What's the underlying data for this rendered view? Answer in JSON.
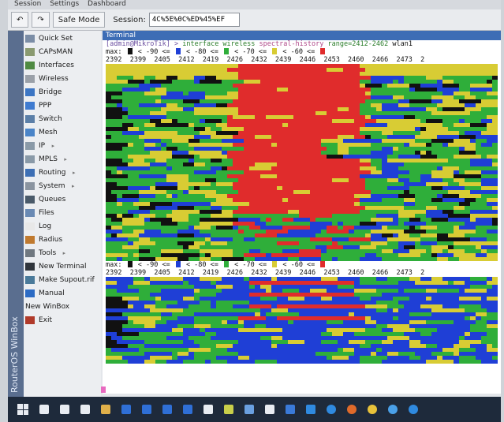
{
  "menubar": [
    "Session",
    "Settings",
    "Dashboard"
  ],
  "toolbar": {
    "undo": "↶",
    "redo": "↷",
    "safe_mode": "Safe Mode",
    "session_label": "Session:",
    "session_value": "4C%5E%0C%ED%45%EF"
  },
  "sidebar": {
    "brand": "RouterOS WinBox",
    "items": [
      {
        "label": "Quick Set",
        "icon": "quick-set-icon",
        "color": "#7b8da6"
      },
      {
        "label": "CAPsMAN",
        "icon": "capsman-icon",
        "color": "#8a9a70"
      },
      {
        "label": "Interfaces",
        "icon": "interfaces-icon",
        "color": "#4f8a42"
      },
      {
        "label": "Wireless",
        "icon": "wireless-icon",
        "color": "#9aa0a8"
      },
      {
        "label": "Bridge",
        "icon": "bridge-icon",
        "color": "#3c76c4"
      },
      {
        "label": "PPP",
        "icon": "ppp-icon",
        "color": "#3f7bd0"
      },
      {
        "label": "Switch",
        "icon": "switch-icon",
        "color": "#5b7fa8"
      },
      {
        "label": "Mesh",
        "icon": "mesh-icon",
        "color": "#4a84c8"
      },
      {
        "label": "IP",
        "icon": "ip-icon",
        "color": "#8a9aa8",
        "arrow": true
      },
      {
        "label": "MPLS",
        "icon": "mpls-icon",
        "color": "#8a9aa8",
        "arrow": true
      },
      {
        "label": "Routing",
        "icon": "routing-icon",
        "color": "#3d6fb5",
        "arrow": true
      },
      {
        "label": "System",
        "icon": "system-icon",
        "color": "#8a94a0",
        "arrow": true
      },
      {
        "label": "Queues",
        "icon": "queues-icon",
        "color": "#4a5a6a"
      },
      {
        "label": "Files",
        "icon": "files-icon",
        "color": "#6a8ab4"
      },
      {
        "label": "Log",
        "icon": "log-icon",
        "color": "#e8e8e8"
      },
      {
        "label": "Radius",
        "icon": "radius-icon",
        "color": "#c07a30"
      },
      {
        "label": "Tools",
        "icon": "tools-icon",
        "color": "#707880",
        "arrow": true
      },
      {
        "label": "New Terminal",
        "icon": "terminal-icon",
        "color": "#30353c"
      },
      {
        "label": "Make Supout.rif",
        "icon": "supout-icon",
        "color": "#4a7a9a"
      },
      {
        "label": "Manual",
        "icon": "manual-icon",
        "color": "#2c6bc4"
      },
      {
        "label": "New WinBox",
        "icon": "",
        "color": ""
      },
      {
        "label": "Exit",
        "icon": "exit-icon",
        "color": "#b03a2a"
      }
    ]
  },
  "terminal": {
    "title": "Terminal",
    "prompt": "[admin@MikroTik] >",
    "command_kw": "interface wireless",
    "command_kw2": "spectral-history",
    "command_args": "range=2412-2462",
    "command_iface": "wlan1",
    "legend": {
      "max": "max:",
      "t1": "< -90 <=",
      "t2": "< -80 <=",
      "t3": "< -70 <=",
      "t4": "< -60 <="
    },
    "freqs": "2392  2399  2405  2412  2419  2426  2432  2439  2446  2453  2460  2466  2473  2",
    "colors": {
      "black": "#111111",
      "blue": "#1f3fd6",
      "green": "#2fae3a",
      "yellow": "#d8cc34",
      "red": "#e02c2c"
    }
  },
  "taskbar": {
    "icons": [
      "start-icon",
      "search-icon",
      "task-view-icon",
      "calculator-icon",
      "file-explorer-icon",
      "app-icon",
      "app-icon",
      "app-icon",
      "app-icon",
      "terminal-app-icon",
      "notes-icon",
      "paint-icon",
      "calendar-icon",
      "mail-icon",
      "edge-icon",
      "ie-icon",
      "firefox-icon",
      "chrome-icon",
      "winbox-icon",
      "settings-icon"
    ]
  }
}
